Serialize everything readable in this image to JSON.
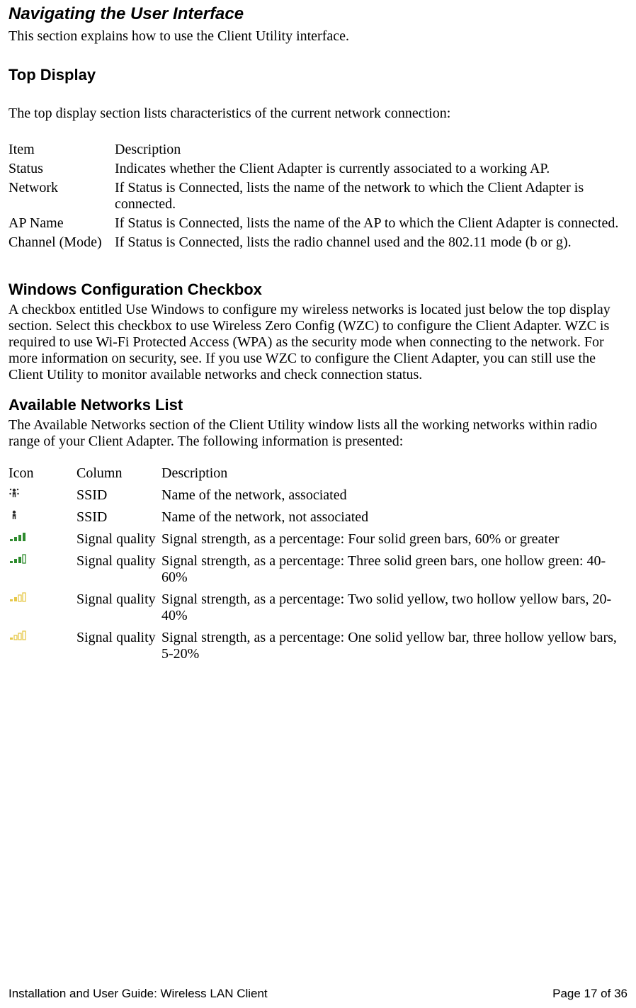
{
  "page": {
    "title": "Navigating the User Interface",
    "intro": "This section explains how to use the Client Utility interface."
  },
  "top_display": {
    "heading": "Top Display",
    "lead": "The top display section lists characteristics of the current network connection:",
    "header": {
      "item": "Item",
      "desc": "Description"
    },
    "rows": [
      {
        "item": "Status",
        "desc": "Indicates whether the Client Adapter is currently associated to a working AP."
      },
      {
        "item": "Network",
        "desc": "If Status is Connected, lists the name of the network to which the Client Adapter is connected."
      },
      {
        "item": "AP Name",
        "desc": "If Status is Connected, lists the name of the AP to which the Client Adapter is connected."
      },
      {
        "item": "Channel (Mode)",
        "desc": "If Status is Connected, lists the radio channel used and the 802.11 mode (b or g)."
      }
    ]
  },
  "wzc": {
    "heading": "Windows Configuration Checkbox",
    "body": "A checkbox entitled Use Windows to configure my wireless networks is located just below the top display section. Select this checkbox to use Wireless Zero Config (WZC) to configure the Client Adapter. WZC is required to use Wi-Fi Protected Access (WPA) as the security mode when connecting to the network. For more information on security, see. If you use WZC to configure the Client Adapter, you can still use the Client Utility to monitor available networks and check connection status."
  },
  "networks": {
    "heading": "Available Networks List",
    "lead": "The Available Networks section of the Client Utility window lists all the working networks within radio range of your Client Adapter. The following information is presented:",
    "header": {
      "icon": "Icon",
      "column": "Column",
      "desc": "Description"
    },
    "rows": [
      {
        "icon": "ssid-associated-icon",
        "column": "SSID",
        "desc": "Name of the network, associated"
      },
      {
        "icon": "ssid-not-associated-icon",
        "column": "SSID",
        "desc": "Name of the network, not associated"
      },
      {
        "icon": "signal-4-icon",
        "column": "Signal quality",
        "desc": "Signal strength, as a percentage: Four solid green bars, 60% or greater"
      },
      {
        "icon": "signal-3-icon",
        "column": "Signal quality",
        "desc": "Signal strength, as a percentage: Three solid green bars, one hollow green: 40-60%"
      },
      {
        "icon": "signal-2-icon",
        "column": "Signal quality",
        "desc": "Signal strength, as a percentage: Two solid yellow, two hollow yellow bars, 20-40%"
      },
      {
        "icon": "signal-1-icon",
        "column": "Signal quality",
        "desc": "Signal strength, as a percentage: One solid yellow bar, three hollow yellow bars, 5-20%"
      }
    ]
  },
  "footer": {
    "left": "Installation and User Guide: Wireless LAN Client",
    "right": "Page 17 of 36"
  }
}
